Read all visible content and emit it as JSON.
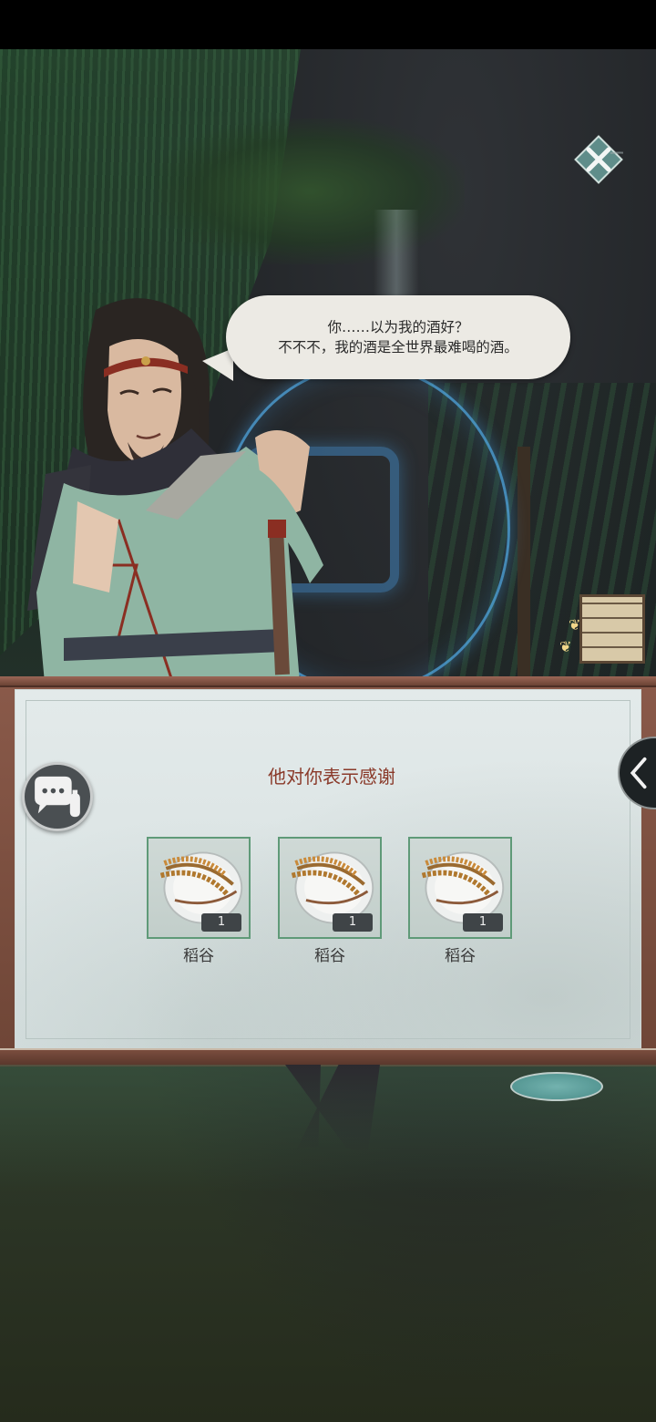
{
  "dialogue": {
    "line1": "你……以为我的酒好？",
    "line2": "不不不，我的酒是全世界最难喝的酒。"
  },
  "reward_panel": {
    "title": "他对你表示感谢",
    "items": [
      {
        "name": "稻谷",
        "count": "1",
        "icon": "rice-grain-icon"
      },
      {
        "name": "稻谷",
        "count": "1",
        "icon": "rice-grain-icon"
      },
      {
        "name": "稻谷",
        "count": "1",
        "icon": "rice-grain-icon"
      }
    ]
  },
  "buttons": {
    "close_icon": "close-icon",
    "chat_icon": "chat-bubble-icon",
    "side_toggle_icon": "chevron-left-icon"
  },
  "colors": {
    "panel_title": "#8a3a2a",
    "item_border": "#5f9a78",
    "speech_bubble": "#eceae4",
    "ring_glow": "#50aae6",
    "frame_wood": "#7a4d3e"
  }
}
